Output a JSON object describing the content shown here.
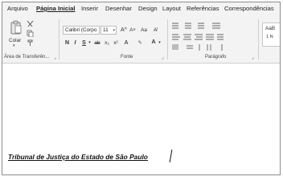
{
  "ribbon_tabs": [
    {
      "label": "Arquivo"
    },
    {
      "label": "Página Inicial"
    },
    {
      "label": "Inserir"
    },
    {
      "label": "Desenhar"
    },
    {
      "label": "Design"
    },
    {
      "label": "Layout"
    },
    {
      "label": "Referências"
    },
    {
      "label": "Correspondências"
    }
  ],
  "clipboard": {
    "paste_label": "Colar",
    "group_label": "Área de Transferên..."
  },
  "font": {
    "font_name": "Calibri (Corpo",
    "font_size": "11",
    "bold": "N",
    "italic": "I",
    "underline": "S",
    "strikethrough": "ab",
    "subscript": "x₂",
    "superscript": "x²",
    "grow": "A^",
    "shrink": "A˅",
    "change_case": "Aa",
    "text_effects": "A",
    "highlight": "✎",
    "font_color": "A",
    "group_label": "Fonte"
  },
  "paragraph": {
    "group_label": "Parágrafo"
  },
  "styles": {
    "sample": "AaB",
    "sample_name": "1 N"
  },
  "document": {
    "text": "Tribunal de Justiça do Estado de São Paulo"
  },
  "colors": {
    "ribbon_bg": "#f3f3f3",
    "accent_red": "#c00000"
  }
}
